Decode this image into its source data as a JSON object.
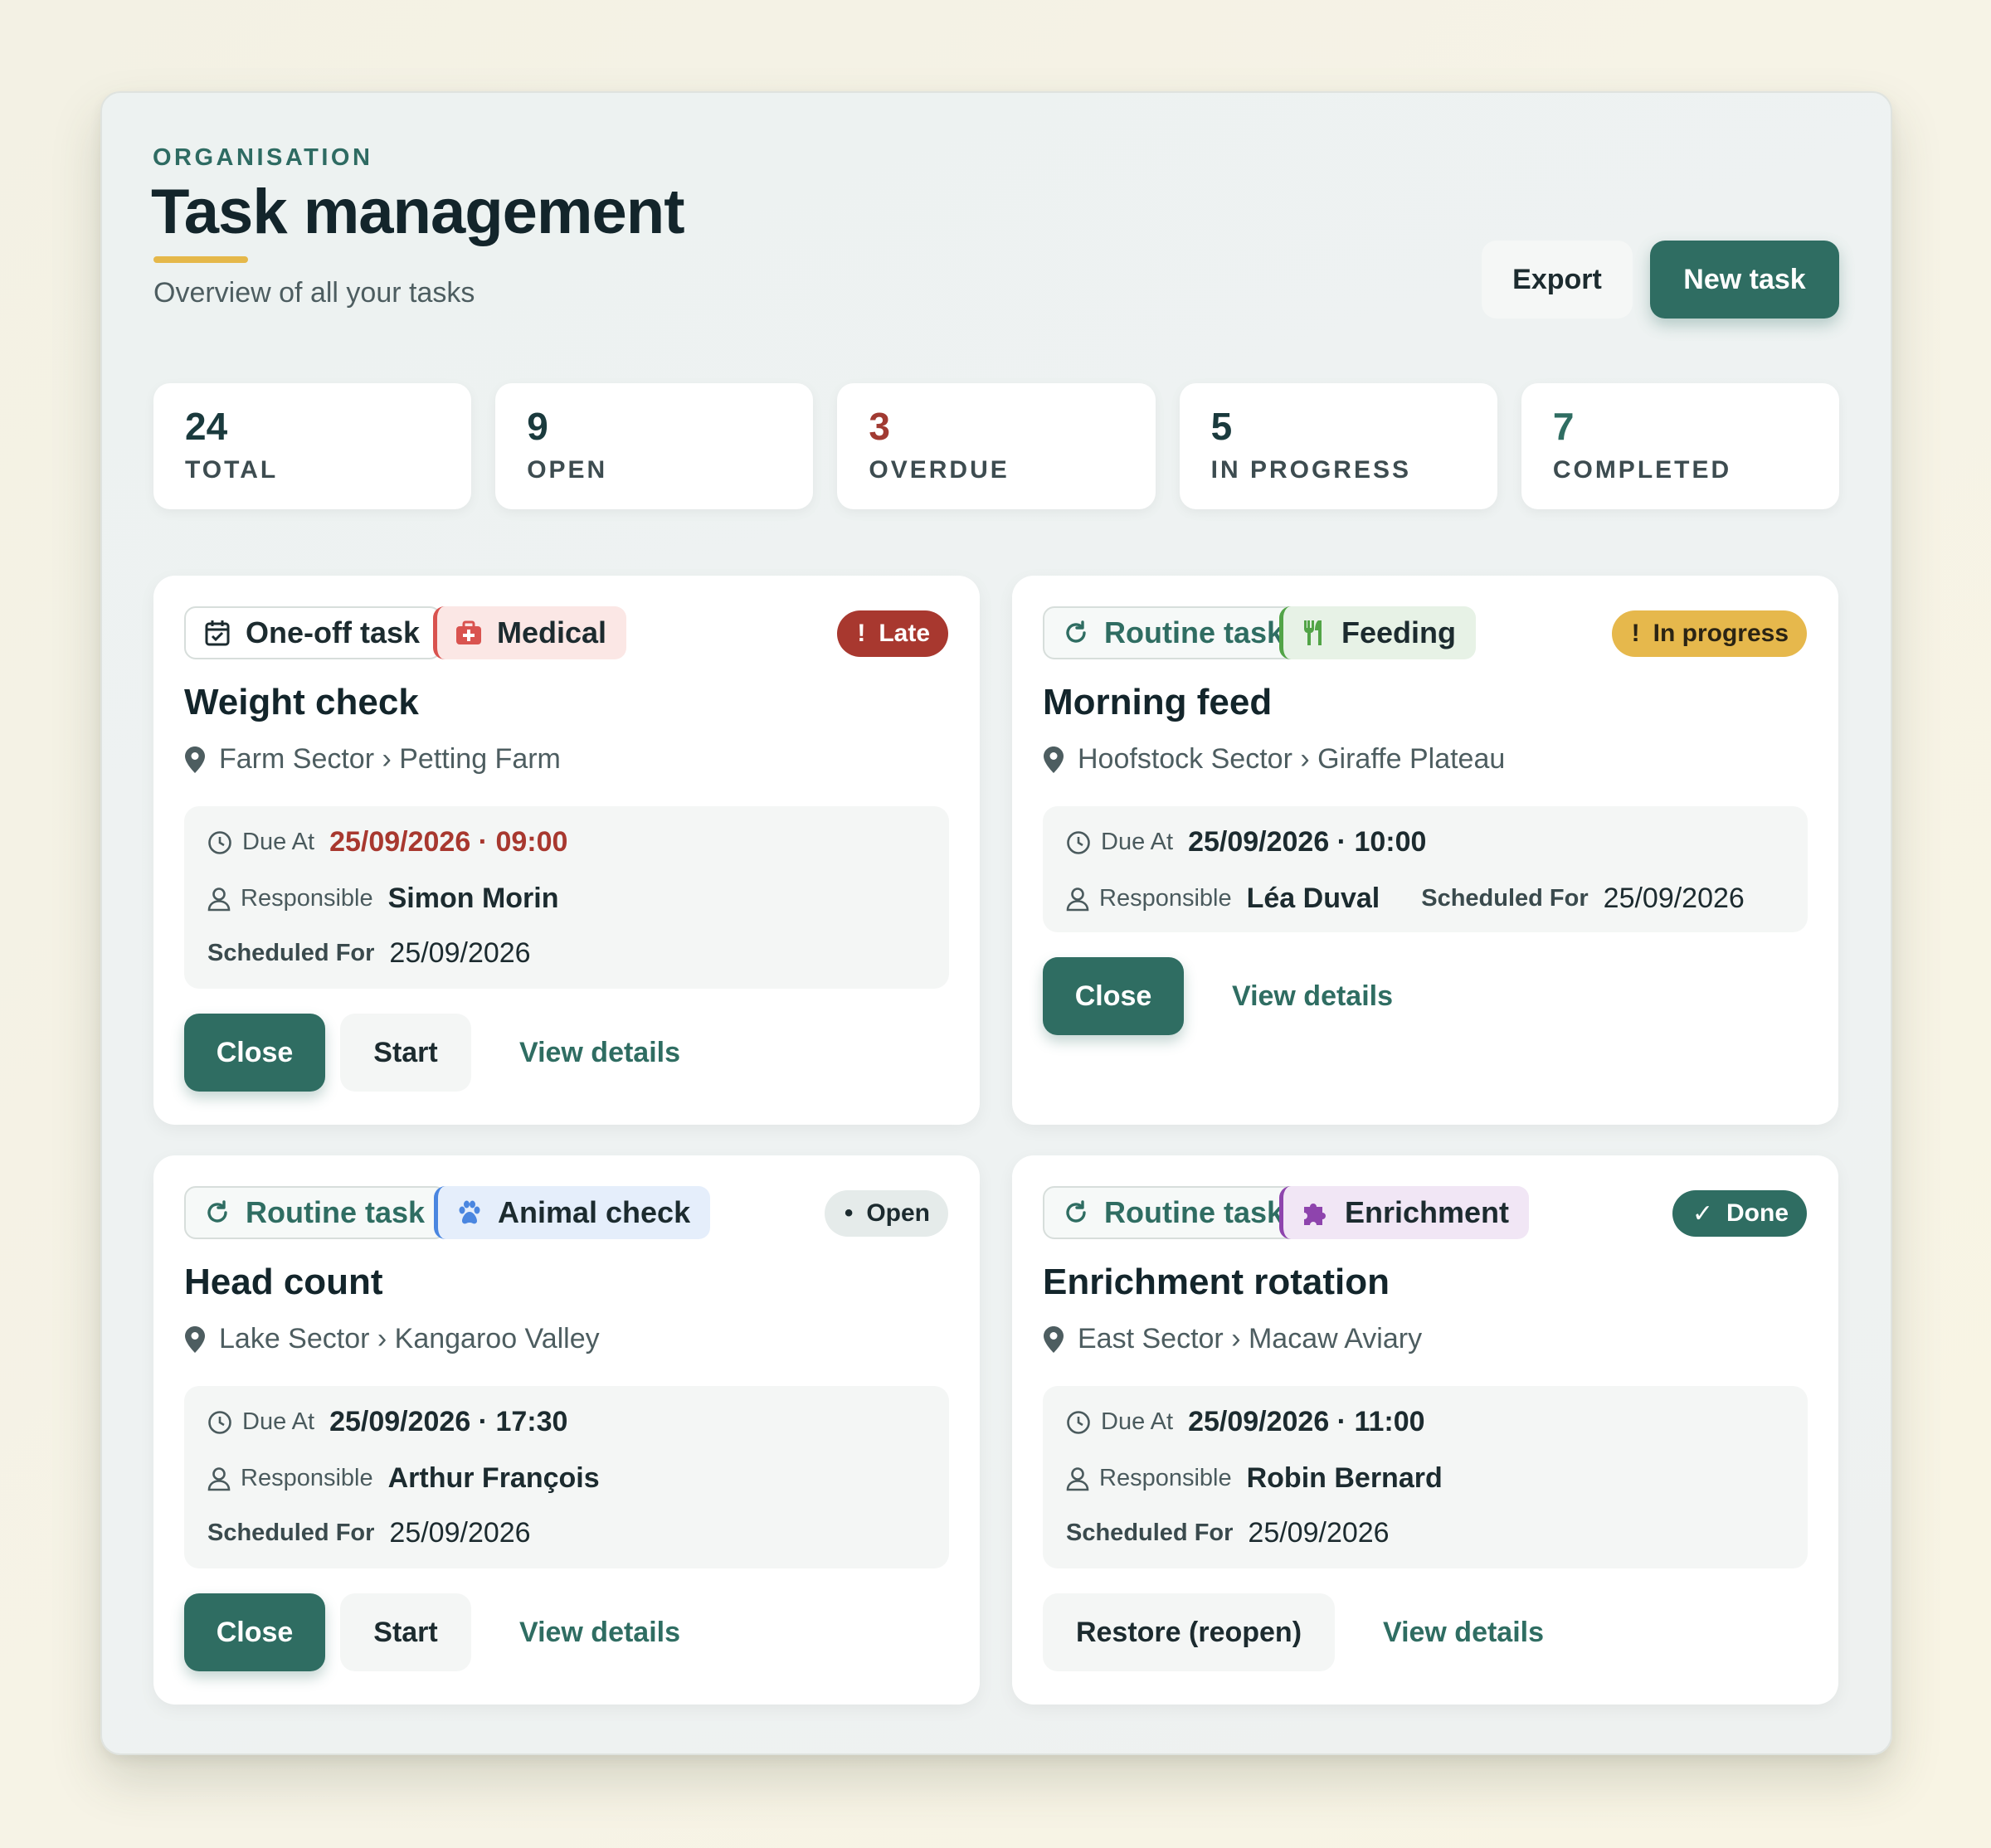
{
  "header": {
    "eyebrow": "ORGANISATION",
    "title": "Task management",
    "subtitle": "Overview of all your tasks",
    "export_label": "Export",
    "new_task_label": "New task"
  },
  "stats": [
    {
      "value": "24",
      "label": "TOTAL"
    },
    {
      "value": "9",
      "label": "OPEN"
    },
    {
      "value": "3",
      "label": "OVERDUE"
    },
    {
      "value": "5",
      "label": "IN PROGRESS"
    },
    {
      "value": "7",
      "label": "COMPLETED"
    }
  ],
  "labels": {
    "due_at": "Due At",
    "responsible": "Responsible",
    "scheduled_for": "Scheduled For",
    "close": "Close",
    "start": "Start",
    "view_details": "View details",
    "restore": "Restore (reopen)"
  },
  "tasks": [
    {
      "type": "One-off task",
      "type_icon": "calendar-check-icon",
      "category": "Medical",
      "category_icon": "first-aid-kit-icon",
      "status": "Late",
      "status_mark": "!",
      "title": "Weight check",
      "location": "Farm Sector › Petting Farm",
      "due": "25/09/2026 · 09:00",
      "responsible": "Simon Morin",
      "scheduled": "25/09/2026"
    },
    {
      "type": "Routine task",
      "type_icon": "refresh-icon",
      "category": "Feeding",
      "category_icon": "utensils-icon",
      "status": "In progress",
      "status_mark": "!",
      "title": "Morning feed",
      "location": "Hoofstock Sector › Giraffe Plateau",
      "due": "25/09/2026 · 10:00",
      "responsible": "Léa Duval",
      "scheduled": "25/09/2026"
    },
    {
      "type": "Routine task",
      "type_icon": "refresh-icon",
      "category": "Animal check",
      "category_icon": "paw-icon",
      "status": "Open",
      "status_mark": "•",
      "title": "Head count",
      "location": "Lake Sector › Kangaroo Valley",
      "due": "25/09/2026 · 17:30",
      "responsible": "Arthur François",
      "scheduled": "25/09/2026"
    },
    {
      "type": "Routine task",
      "type_icon": "refresh-icon",
      "category": "Enrichment",
      "category_icon": "puzzle-icon",
      "status": "Done",
      "status_mark": "✓",
      "title": "Enrichment rotation",
      "location": "East Sector › Macaw Aviary",
      "due": "25/09/2026 · 11:00",
      "responsible": "Robin Bernard",
      "scheduled": "25/09/2026"
    }
  ],
  "colors": {
    "brand": "#2f6d62",
    "danger": "#a8382f",
    "warning": "#e6b84c",
    "accent_underline": "#e5b84a"
  }
}
